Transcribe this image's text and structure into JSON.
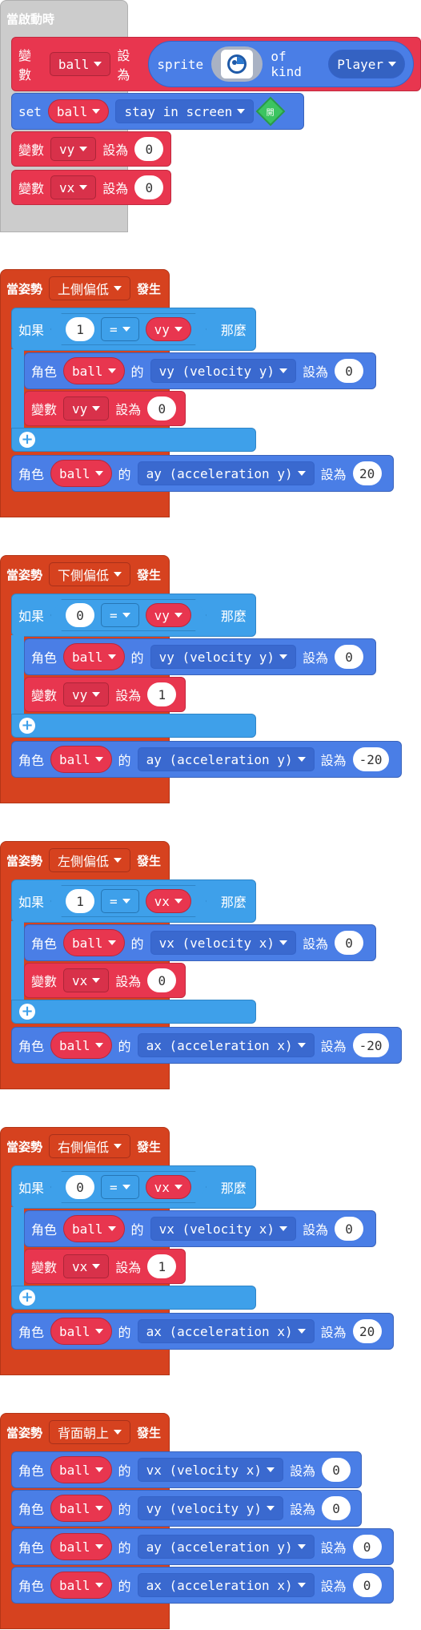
{
  "colors": {
    "red": "#e8364f",
    "blue": "#4a7ee6",
    "light_blue": "#3ea0ea",
    "orange": "#d6421f",
    "gray": "#cccccc"
  },
  "start": {
    "hat": "當啟動時",
    "set_var_label": "變數",
    "ball": "ball",
    "to": "設為",
    "sprite": "sprite",
    "of_kind": "of kind",
    "player": "Player",
    "set": "set",
    "stay": "stay in screen",
    "on": "開",
    "vy": "vy",
    "vx": "vx",
    "zero": "0",
    "sprite_icon": "ball-sprite-icon"
  },
  "common": {
    "gesture": "當姿勢",
    "happens": "發生",
    "if": "如果",
    "then": "那麼",
    "eq": "=",
    "sprite_label": "角色",
    "of": "的",
    "set_to": "設為",
    "variable": "變數",
    "ball": "ball"
  },
  "g1": {
    "gesture": "上側偏低",
    "cmp": "1",
    "var": "vy",
    "prop1": "vy (velocity y)",
    "v1": "0",
    "setvar": "vy",
    "v2": "0",
    "prop2": "ay (acceleration y)",
    "v3": "20"
  },
  "g2": {
    "gesture": "下側偏低",
    "cmp": "0",
    "var": "vy",
    "prop1": "vy (velocity y)",
    "v1": "0",
    "setvar": "vy",
    "v2": "1",
    "prop2": "ay (acceleration y)",
    "v3": "-20"
  },
  "g3": {
    "gesture": "左側偏低",
    "cmp": "1",
    "var": "vx",
    "prop1": "vx (velocity x)",
    "v1": "0",
    "setvar": "vx",
    "v2": "0",
    "prop2": "ax (acceleration x)",
    "v3": "-20"
  },
  "g4": {
    "gesture": "右側偏低",
    "cmp": "0",
    "var": "vx",
    "prop1": "vx (velocity x)",
    "v1": "0",
    "setvar": "vx",
    "v2": "1",
    "prop2": "ax (acceleration x)",
    "v3": "20"
  },
  "g5": {
    "gesture": "背面朝上",
    "rows": [
      {
        "prop": "vx (velocity x)",
        "val": "0"
      },
      {
        "prop": "vy (velocity y)",
        "val": "0"
      },
      {
        "prop": "ay (acceleration y)",
        "val": "0"
      },
      {
        "prop": "ax (acceleration x)",
        "val": "0"
      }
    ]
  }
}
